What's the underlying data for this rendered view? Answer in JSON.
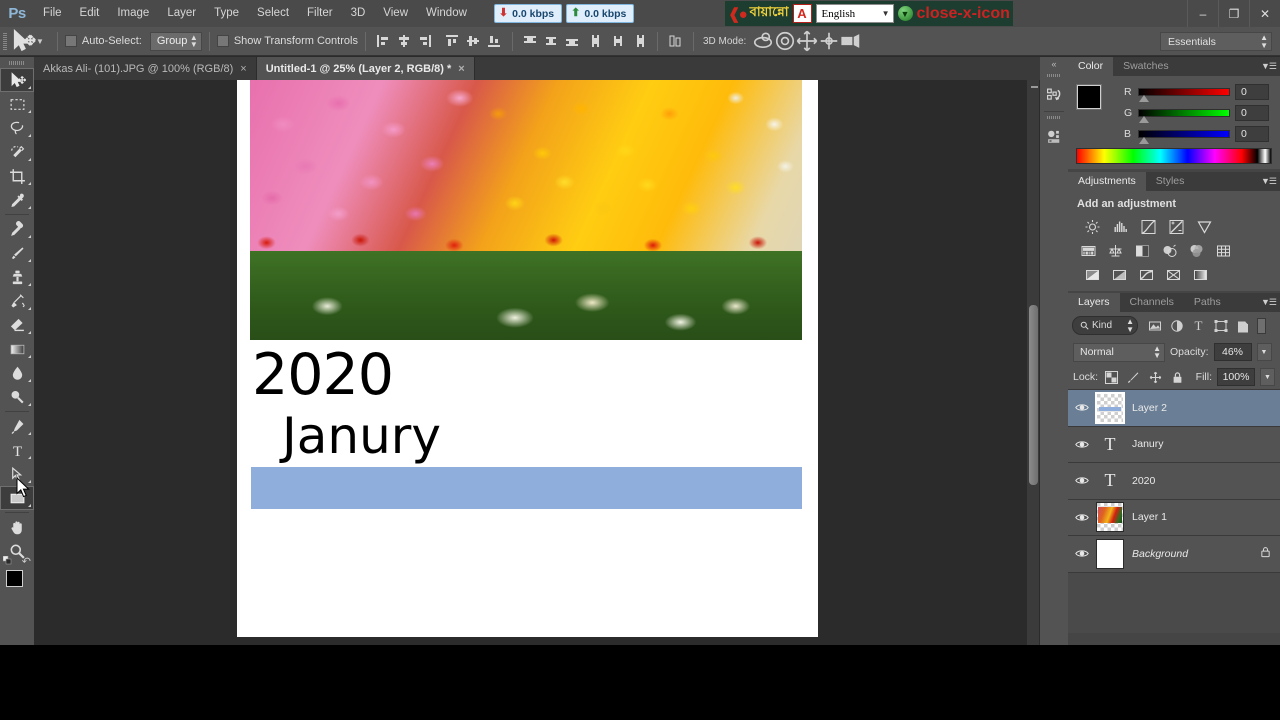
{
  "app": {
    "logo": "Ps",
    "title": "Adobe Photoshop"
  },
  "menubar": {
    "items": [
      "File",
      "Edit",
      "Image",
      "Layer",
      "Type",
      "Select",
      "Filter",
      "3D",
      "View",
      "Window"
    ],
    "network": {
      "download": "0.0 kbps",
      "upload": "0.0 kbps",
      "down_arrow": "down-arrow-icon",
      "up_arrow": "up-arrow-icon"
    },
    "bijoy": {
      "brand": "বায়ান্নো",
      "mark": "A",
      "language": "English",
      "globe": "globe-icon",
      "close": "close-x-icon"
    },
    "window_controls": {
      "minimize": "–",
      "restore": "❐",
      "close": "✕"
    }
  },
  "options_bar": {
    "tool_icon": "move-tool-icon",
    "auto_select_label": "Auto-Select:",
    "auto_select_checked": false,
    "auto_select_scope": "Group",
    "show_transform_label": "Show Transform Controls",
    "show_transform_checked": false,
    "align_icons": [
      "align-left-edges-icon",
      "align-horizontal-centers-icon",
      "align-right-edges-icon",
      "align-top-edges-icon",
      "align-vertical-centers-icon",
      "align-bottom-edges-icon"
    ],
    "distribute_icons": [
      "distribute-top-edges-icon",
      "distribute-vertical-centers-icon",
      "distribute-bottom-edges-icon",
      "distribute-left-edges-icon",
      "distribute-horizontal-centers-icon",
      "distribute-right-edges-icon"
    ],
    "auto_align_icon": "auto-align-layers-icon",
    "mode3d_label": "3D Mode:",
    "mode3d_icons": [
      "orbit-3d-icon",
      "roll-3d-icon",
      "pan-3d-icon",
      "slide-3d-icon",
      "scale-3d-icon"
    ],
    "workspace": "Essentials"
  },
  "tabs": [
    {
      "title": "Akkas Ali- (101).JPG @ 100% (RGB/8)",
      "active": false,
      "close": "×"
    },
    {
      "title": "Untitled-1 @ 25% (Layer 2, RGB/8) *",
      "active": true,
      "close": "×"
    }
  ],
  "toolbar": {
    "tools_top": [
      {
        "name": "move-tool",
        "selected": true
      },
      {
        "name": "rectangular-marquee-tool",
        "selected": false
      },
      {
        "name": "lasso-tool",
        "selected": false
      },
      {
        "name": "quick-selection-tool",
        "selected": false
      },
      {
        "name": "crop-tool",
        "selected": false
      },
      {
        "name": "eyedropper-tool",
        "selected": false
      }
    ],
    "tools_mid": [
      {
        "name": "spot-healing-brush-tool",
        "selected": false
      },
      {
        "name": "brush-tool",
        "selected": false
      },
      {
        "name": "clone-stamp-tool",
        "selected": false
      },
      {
        "name": "history-brush-tool",
        "selected": false
      },
      {
        "name": "eraser-tool",
        "selected": false
      },
      {
        "name": "gradient-tool",
        "selected": false
      },
      {
        "name": "blur-tool",
        "selected": false
      },
      {
        "name": "dodge-tool",
        "selected": false
      }
    ],
    "tools_bottom": [
      {
        "name": "pen-tool",
        "selected": false
      },
      {
        "name": "horizontal-type-tool",
        "selected": false
      },
      {
        "name": "path-selection-tool",
        "selected": false
      },
      {
        "name": "rectangle-tool",
        "selected": true
      }
    ],
    "tools_nav": [
      {
        "name": "hand-tool",
        "selected": false
      },
      {
        "name": "zoom-tool",
        "selected": false
      }
    ],
    "foreground_color": "#000000",
    "background_color": "#2a5caa"
  },
  "canvas": {
    "document": {
      "photo_alt": "tulip-field-photo",
      "year_text": "2020",
      "month_text": "Janury",
      "bar_color": "#8faedc"
    },
    "scrollbar": "vertical-scrollbar"
  },
  "mini_dock": {
    "collapse": "«",
    "buttons": [
      "history-panel-icon",
      "mini-bridge-panel-icon"
    ]
  },
  "panels": {
    "color": {
      "tabs": [
        {
          "label": "Color",
          "active": true
        },
        {
          "label": "Swatches",
          "active": false
        }
      ],
      "menu_icon": "panel-menu-icon",
      "channels": [
        {
          "label": "R",
          "value": "0"
        },
        {
          "label": "G",
          "value": "0"
        },
        {
          "label": "B",
          "value": "0"
        }
      ],
      "foreground": "#000000",
      "background": "#2a5caa"
    },
    "adjustments": {
      "tabs": [
        {
          "label": "Adjustments",
          "active": true
        },
        {
          "label": "Styles",
          "active": false
        }
      ],
      "menu_icon": "panel-menu-icon",
      "title": "Add an adjustment",
      "row1": [
        "brightness-contrast-icon",
        "levels-icon",
        "curves-icon",
        "exposure-icon",
        "vibrance-icon"
      ],
      "row2": [
        "hue-saturation-icon",
        "color-balance-icon",
        "black-white-icon",
        "photo-filter-icon",
        "channel-mixer-icon",
        "color-lookup-icon"
      ],
      "row3": [
        "invert-icon",
        "posterize-icon",
        "threshold-icon",
        "selective-color-icon",
        "gradient-map-icon"
      ]
    },
    "layers": {
      "tabs": [
        {
          "label": "Layers",
          "active": true
        },
        {
          "label": "Channels",
          "active": false
        },
        {
          "label": "Paths",
          "active": false
        }
      ],
      "menu_icon": "panel-menu-icon",
      "filter_kind": "Kind",
      "filter_icons": [
        "filter-pixel-icon",
        "filter-adjustment-icon",
        "filter-type-icon",
        "filter-shape-icon",
        "filter-smart-object-icon"
      ],
      "blend_mode": "Normal",
      "opacity_label": "Opacity:",
      "opacity_value": "46%",
      "lock_label": "Lock:",
      "lock_icons": [
        "lock-transparent-pixels-icon",
        "lock-image-pixels-icon",
        "lock-position-icon",
        "lock-all-icon"
      ],
      "fill_label": "Fill:",
      "fill_value": "100%",
      "items": [
        {
          "name": "Layer 2",
          "type": "pixel",
          "visible": true,
          "selected": true,
          "locked": false,
          "italic": false
        },
        {
          "name": "Janury",
          "type": "text",
          "visible": true,
          "selected": false,
          "locked": false,
          "italic": false
        },
        {
          "name": "2020",
          "type": "text",
          "visible": true,
          "selected": false,
          "locked": false,
          "italic": false
        },
        {
          "name": "Layer 1",
          "type": "photo",
          "visible": true,
          "selected": false,
          "locked": false,
          "italic": false
        },
        {
          "name": "Background",
          "type": "white",
          "visible": true,
          "selected": false,
          "locked": true,
          "italic": true
        }
      ],
      "lock_badge": "🔒"
    }
  }
}
